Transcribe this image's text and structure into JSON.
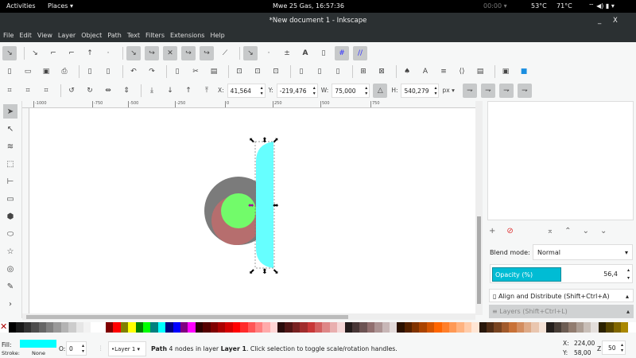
{
  "topbar": {
    "activities": "Activities",
    "places": "Places ▾",
    "clock": "Mwe 25 Gas, 16:57:36",
    "timer": "00:00 ▾",
    "temp1": "53°C",
    "temp2": "71°C"
  },
  "window": {
    "title": "*New document 1 - Inkscape",
    "minimize": "_",
    "close": "X"
  },
  "menu": [
    "File",
    "Edit",
    "View",
    "Layer",
    "Object",
    "Path",
    "Text",
    "Filters",
    "Extensions",
    "Help"
  ],
  "toolbar_select": {
    "x_label": "X:",
    "x": "41,564",
    "y_label": "Y:",
    "y": "-219,476",
    "w_label": "W:",
    "w": "75,000",
    "h_label": "H:",
    "h": "540,279",
    "unit": "px"
  },
  "ruler": [
    "-1000",
    "-750",
    "-500",
    "-250",
    "0",
    "250",
    "500",
    "750"
  ],
  "panel": {
    "blend_label": "Blend mode:",
    "blend_value": "Normal",
    "opacity_label": "Opacity (%)",
    "opacity_value": "56,4",
    "opacity_fraction": 0.564,
    "align": "Align and Distribute (Shift+Ctrl+A)",
    "layers": "Layers (Shift+Ctrl+L)"
  },
  "status": {
    "fill_label": "Fill:",
    "stroke_label": "Stroke:",
    "stroke_value": "None",
    "fill_color": "#00ffff",
    "o_label": "O:",
    "o_value": "0",
    "layer": "•Layer 1",
    "message_bold": "Path",
    "message": " 4 nodes in layer ",
    "layer_bold": "Layer 1",
    "message_end": ". Click selection to toggle scale/rotation handles.",
    "x_label": "X:",
    "x": "224,00",
    "y_label": "Y:",
    "y": "58,00",
    "z_label": "Z:",
    "zoom": "50"
  },
  "palette": [
    "#000000",
    "#1a1a1a",
    "#333333",
    "#4d4d4d",
    "#666666",
    "#808080",
    "#999999",
    "#b3b3b3",
    "#cccccc",
    "#e6e6e6",
    "#f2f2f2",
    "#ffffff",
    "#ffffff",
    "#800000",
    "#ff0000",
    "#808000",
    "#ffff00",
    "#008000",
    "#00ff00",
    "#008080",
    "#00ffff",
    "#000080",
    "#0000ff",
    "#800080",
    "#ff00ff",
    "#2b0000",
    "#550000",
    "#800000",
    "#aa0000",
    "#d40000",
    "#ff0000",
    "#ff2a2a",
    "#ff5555",
    "#ff8080",
    "#ffaaaa",
    "#ffd5d5",
    "#280b0b",
    "#501616",
    "#782121",
    "#a02c2c",
    "#c83737",
    "#d35f5f",
    "#de8787",
    "#e9afaf",
    "#f4d7d7",
    "#241c1c",
    "#483737",
    "#6c5353",
    "#916f6f",
    "#ac9393",
    "#c8b7b7",
    "#e3dbdb",
    "#2b1100",
    "#552200",
    "#803300",
    "#aa4400",
    "#d45500",
    "#ff6600",
    "#ff7f2a",
    "#ff9955",
    "#ffb380",
    "#ffccaa",
    "#ffe6d5",
    "#28170b",
    "#502d16",
    "#784421",
    "#a05a2c",
    "#c87137",
    "#d38d5f",
    "#deaa87",
    "#e9c6af",
    "#f4e3d7",
    "#241f1c",
    "#483e37",
    "#6c5d53",
    "#917c6f",
    "#ac9d93",
    "#c8beb7",
    "#e3dedb",
    "#2b2200",
    "#554400",
    "#806600",
    "#aa8800"
  ]
}
